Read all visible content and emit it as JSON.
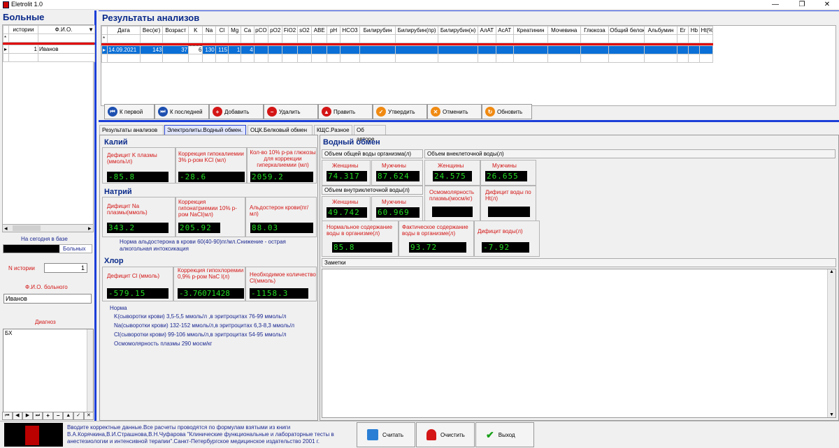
{
  "window": {
    "title": "Eletrolit 1.0",
    "minimize": "—",
    "restore": "❐",
    "close": "✕"
  },
  "patients_panel": {
    "title": "Больные",
    "columns": [
      "истории",
      "Ф.И.О."
    ],
    "rows": [
      {
        "id": "1",
        "name": "Иванов"
      }
    ],
    "today_label": "На сегодня в базе",
    "count_suffix": "Больных",
    "history_label": "N истории",
    "history_value": "1",
    "fio_label": "Ф.И.О. больного",
    "fio_value": "Иванов",
    "diag_label": "Диагноз",
    "diag_value": "БХ",
    "nav": [
      "⏮",
      "◀",
      "▶",
      "⏭",
      "+",
      "−",
      "▲",
      "✓",
      "✕"
    ]
  },
  "results_panel": {
    "title": "Результаты анализов",
    "columns": [
      "Дата",
      "Вес(кг)",
      "Возраст",
      "K",
      "Na",
      "Cl",
      "Mg",
      "Ca",
      "pCO",
      "pO2",
      "FiO2",
      "sO2",
      "ABE",
      "pH",
      "HCO3",
      "Билирубин",
      "Билирубин(пр)",
      "Билирубин(н)",
      "АлАТ",
      "АсАТ",
      "Креатинин",
      "Мочевина",
      "Глюкоза",
      "Общий белок",
      "Альбумин",
      "Er",
      "Hb",
      "Ht(%"
    ],
    "row": [
      "14.09.2021",
      "143",
      "37",
      "6",
      "130",
      "115",
      "1",
      "4",
      "",
      "",
      "",
      "",
      "",
      "",
      "",
      "",
      "",
      "",
      "",
      "",
      "",
      "",
      "",
      "",
      "",
      "",
      "",
      ""
    ]
  },
  "buttons": {
    "first": "К первой",
    "last": "К последней",
    "add": "Добавить",
    "delete": "Удалить",
    "edit": "Править",
    "confirm": "Утвердить",
    "cancel": "Отменить",
    "refresh": "Обновить"
  },
  "tabs": [
    "Результаты анализов",
    "Электролиты.Водный обмен.",
    "ОЦК.Белковый обмен",
    "КЩС.Разное",
    "Об авторе"
  ],
  "potassium": {
    "title": "Калий",
    "deficit_label": "Дефицит K плазмы (ммоль\\л)",
    "deficit_value": "-85.8",
    "corr_label": "Коррекция гипокалиемии 3% р-ром KCl (мл)",
    "corr_value": "-28.6",
    "glucose_label": "Кол-во 10% р-ра глюкозы для коррекции гиперкалиемии (мл)",
    "glucose_value": "2059.2"
  },
  "sodium": {
    "title": "Натрий",
    "deficit_label": "Дифицит Na плазмы(ммоль)",
    "deficit_value": "343.2",
    "corr_label": "Коррекция гипонатриемии 10% р-ром NaCl(мл)",
    "corr_value": "205.92",
    "ald_label": "Альдостерон крови(пг/мл)",
    "ald_value": "88.03",
    "note": "Норма альдостерона в крови 60(40-90)пг/мл.Снижение - острая алкогольная интоксикация"
  },
  "chlorine": {
    "title": "Хлор",
    "deficit_label": "Дефицит Cl (ммоль)",
    "deficit_value": "-579.15",
    "corr_label": "Коррекция гипохлоремии 0,9% р-ром NaC l(л)",
    "corr_value": "-3.76071428",
    "need_label": "Необходимое количество Cl(ммоль)",
    "need_value": "-1158.3"
  },
  "norms": {
    "title": "Норма",
    "lines": [
      "K(сыворотки крови) 3,5-5,5 ммоль/л ,в эритроцитах 76-99 ммоль/л",
      "Na(сыворотки крови) 132-152 ммоль/л,в эритроцитах 6,3-8,3 ммоль/л",
      "Cl(сыворотки крови) 99-106 ммоль/л,в эритроцитах 54-95 ммоль/л",
      "Осмомолярность плазмы 290 мосм/кг"
    ]
  },
  "water": {
    "title": "Водный обмен",
    "total_label": "Объем общей воды организма(л)",
    "extra_label": "Объем внеклеточной воды(л)",
    "women": "Женщины",
    "men": "Мужчины",
    "total_women": "74.317",
    "total_men": "87.624",
    "extra_women": "24.575",
    "extra_men": "26.655",
    "intra_label": "Объем внутриклеточной воды(л)",
    "intra_women": "49.742",
    "intra_men": "60.969",
    "osmo_label": "Осмомолярность плазмы(мосм/кг)",
    "osmo_value": "",
    "deficit_ht_label": "Дифицит воды по Ht(л)",
    "deficit_ht_value": "",
    "normal_label": "Нормальное содержание воды в организме(л)",
    "normal_value": "85.8",
    "actual_label": "Фактическое содержание воды в организме(л)",
    "actual_value": "93.72",
    "deficit_label": "Дифицит воды(л)",
    "deficit_value": "-7.92"
  },
  "notes": {
    "label": "Заметки"
  },
  "status": {
    "message": "Вводите корректные данные.Все расчеты проводятся по формулам  взятыми из книги В.А.Корячкина,В.И.Страшнова,В.Н.Чуфарова \"Клинические функциональные и лабораторные тесты в анестезиологии и интенсивной терапии\".Санкт-Петербургское медицинское издательство 2001 г.",
    "calc": "Считать",
    "clear": "Очистить",
    "exit": "Выход"
  }
}
